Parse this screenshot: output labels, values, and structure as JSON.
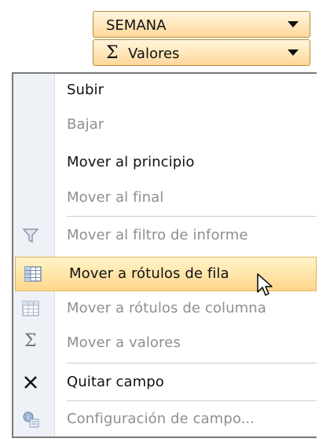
{
  "fields": [
    {
      "label": "SEMANA"
    },
    {
      "label": "Valores",
      "sigma": "Σ"
    }
  ],
  "menu": {
    "items": [
      {
        "label": "Subir",
        "enabled": true
      },
      {
        "label": "Bajar",
        "enabled": false
      },
      {
        "label": "Mover al principio",
        "enabled": true
      },
      {
        "label": "Mover al final",
        "enabled": false
      },
      {
        "label": "Mover al filtro de informe",
        "enabled": false,
        "icon": "filter-icon"
      },
      {
        "label": "Mover a rótulos de fila",
        "enabled": true,
        "icon": "row-labels-icon",
        "highlighted": true
      },
      {
        "label": "Mover a rótulos de columna",
        "enabled": false,
        "icon": "column-labels-icon"
      },
      {
        "label": "Mover a valores",
        "enabled": false,
        "icon": "sigma-icon",
        "icon_glyph": "Σ"
      },
      {
        "label": "Quitar campo",
        "enabled": true,
        "icon": "remove-x-icon"
      },
      {
        "label": "Configuración de campo...",
        "enabled": false,
        "icon": "field-settings-icon"
      }
    ]
  },
  "colors": {
    "highlight": "#ffd68a",
    "disabled_text": "#8f8f8f",
    "field_gradient_top": "#fff6dd",
    "field_gradient_bottom": "#ffd79a"
  }
}
